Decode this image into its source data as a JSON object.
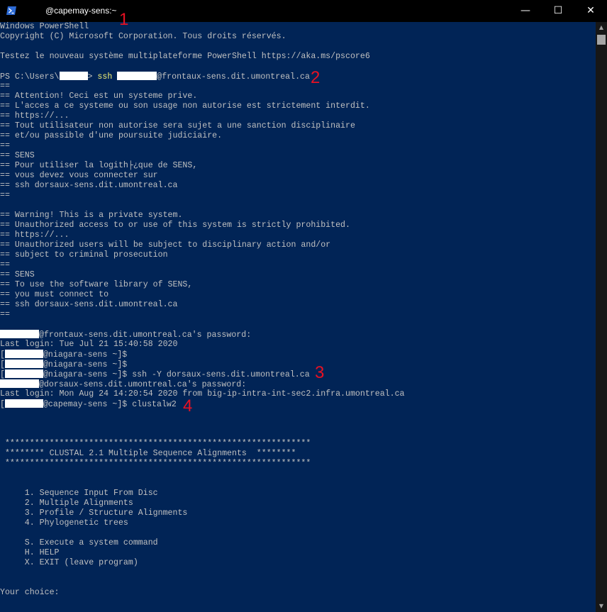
{
  "window": {
    "title": "@capemay-sens:~",
    "minimize": "—",
    "maximize": "☐",
    "close": "✕"
  },
  "colors": {
    "background": "#012456",
    "text": "#c0c0c0",
    "highlight": "#f3f075",
    "marker": "#e81123"
  },
  "terminal": {
    "l01": "Windows PowerShell",
    "l02": "Copyright (C) Microsoft Corporation. Tous droits réservés.",
    "l03": "Testez le nouveau système multiplateforme PowerShell https://aka.ms/pscore6",
    "l04a": "PS C:\\Users\\",
    "l04b": "> ",
    "l04c": "ssh ",
    "l04d": "@frontaux-sens.dit.umontreal.ca",
    "l05": "==",
    "l06": "== Attention! Ceci est un systeme prive.",
    "l07": "== L'acces a ce systeme ou son usage non autorise est strictement interdit.",
    "l08": "== https://...",
    "l09": "== Tout utilisateur non autorise sera sujet a une sanction disciplinaire",
    "l10": "== et/ou passible d'une poursuite judiciaire.",
    "l11": "==",
    "l12": "== SENS",
    "l13": "== Pour utiliser la logith├¿que de SENS,",
    "l14": "== vous devez vous connecter sur",
    "l15": "== ssh dorsaux-sens.dit.umontreal.ca",
    "l16": "==",
    "l17": "== Warning! This is a private system.",
    "l18": "== Unauthorized access to or use of this system is strictly prohibited.",
    "l19": "== https://...",
    "l20": "== Unauthorized users will be subject to disciplinary action and/or",
    "l21": "== subject to criminal prosecution",
    "l22": "==",
    "l23": "== SENS",
    "l24": "== To use the software library of SENS,",
    "l25": "== you must connect to",
    "l26": "== ssh dorsaux-sens.dit.umontreal.ca",
    "l27": "==",
    "l28": "@frontaux-sens.dit.umontreal.ca's password:",
    "l29": "Last login: Tue Jul 21 15:40:58 2020",
    "l30": "@niagara-sens ~]$",
    "l31": "@niagara-sens ~]$",
    "l32": "@niagara-sens ~]$ ssh -Y dorsaux-sens.dit.umontreal.ca",
    "l33": "@dorsaux-sens.dit.umontreal.ca's password:",
    "l34": "Last login: Mon Aug 24 14:20:54 2020 from big-ip-intra-int-sec2.infra.umontreal.ca",
    "l35": "@capemay-sens ~]$ clustalw2",
    "bracket": "[",
    "stars": " **************************************************************",
    "clustal_title": " ******** CLUSTAL 2.1 Multiple Sequence Alignments  ********",
    "menu1": "     1. Sequence Input From Disc",
    "menu2": "     2. Multiple Alignments",
    "menu3": "     3. Profile / Structure Alignments",
    "menu4": "     4. Phylogenetic trees",
    "menuS": "     S. Execute a system command",
    "menuH": "     H. HELP",
    "menuX": "     X. EXIT (leave program)",
    "prompt": "Your choice:"
  },
  "markers": [
    "1",
    "2",
    "3",
    "4"
  ],
  "icons": {
    "app": "powershell-icon",
    "scroll_up": "scroll-up-arrow-icon",
    "scroll_down": "scroll-down-arrow-icon"
  }
}
